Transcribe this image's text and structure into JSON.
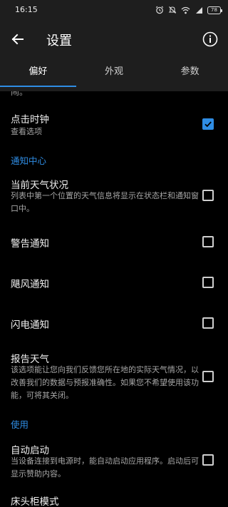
{
  "status_bar": {
    "time": "16:15",
    "battery": "78",
    "icons": [
      "alarm-icon",
      "mute-icon",
      "wifi-icon",
      "cellular-signal-icon",
      "battery-icon"
    ]
  },
  "app_bar": {
    "title": "设置",
    "back_icon": "back-arrow-icon",
    "info_icon": "info-icon"
  },
  "tabs": [
    {
      "label": "偏好",
      "active": true
    },
    {
      "label": "外观",
      "active": false
    },
    {
      "label": "参数",
      "active": false
    }
  ],
  "content": {
    "cut_off_text": "闹。",
    "clock_tap": {
      "title": "点击时钟",
      "desc": "查看选项",
      "checked": true
    },
    "notification_header": "通知中心",
    "current_weather": {
      "title": "当前天气状况",
      "desc": "列表中第一个位置的天气信息将显示在状态栏和通知窗口中。",
      "checked": false
    },
    "alert_notify": {
      "title": "警告通知",
      "checked": false
    },
    "typhoon_notify": {
      "title": "飓风通知",
      "checked": false
    },
    "lightning_notify": {
      "title": "闪电通知",
      "checked": false
    },
    "report_weather": {
      "title": "报告天气",
      "desc": "该选项能让您向我们反馈您所在地的实际天气情况，以改善我们的数据与预报准确性。如果您不希望使用该功能，可将其关闭。",
      "checked": false
    },
    "usage_header": "使用",
    "auto_start": {
      "title": "自动启动",
      "desc": "当设备连接到电源时，能自动启动应用程序。启动后可显示赞助内容。",
      "checked": false
    },
    "bedside_mode": {
      "title": "床头柜模式"
    }
  },
  "colors": {
    "accent": "#2f8de4",
    "bar_background": "#1e1e1e",
    "page_background": "#000000"
  }
}
